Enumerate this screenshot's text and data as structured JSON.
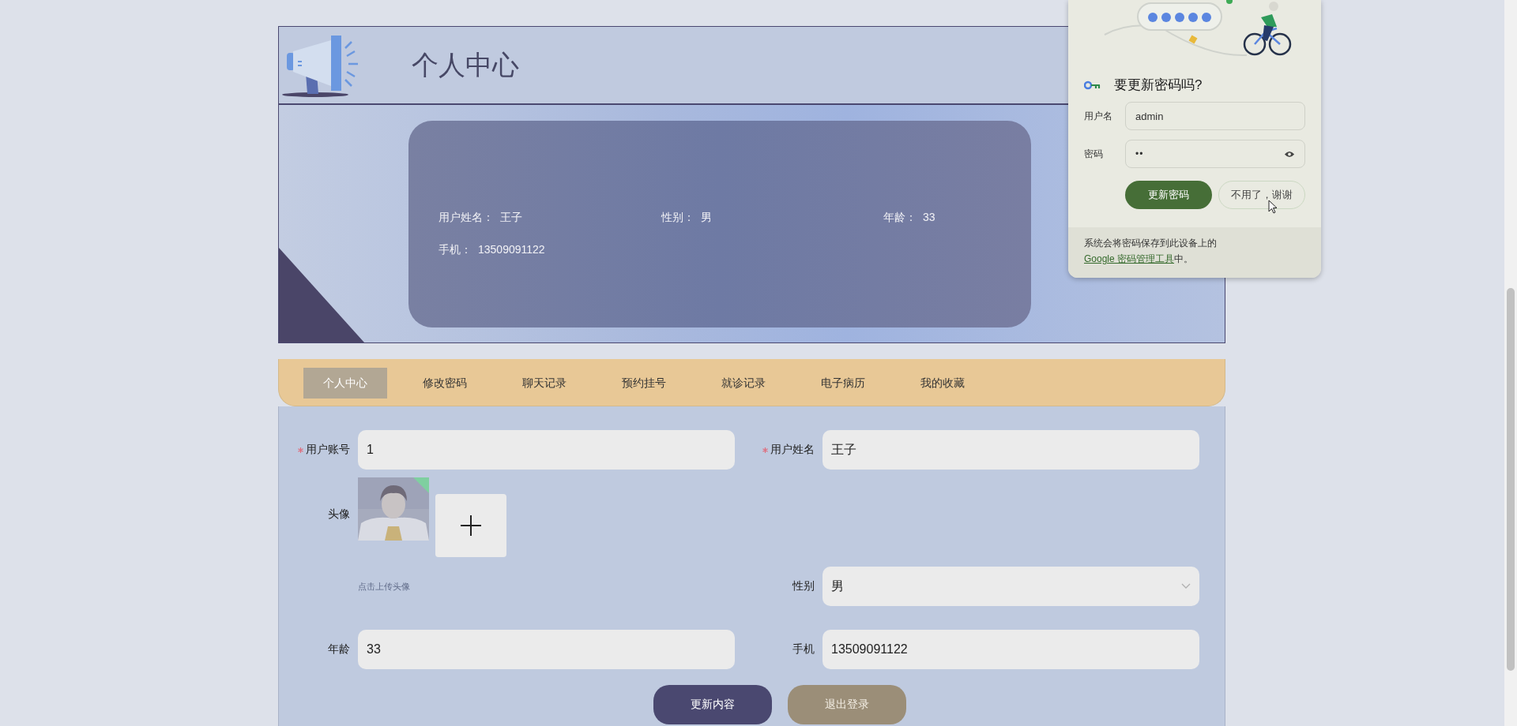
{
  "header": {
    "title": "个人中心"
  },
  "profile": {
    "fields": [
      {
        "label": "用户姓名：",
        "value": "王子"
      },
      {
        "label": "性别：",
        "value": "男"
      },
      {
        "label": "年龄：",
        "value": "33"
      },
      {
        "label": "手机：",
        "value": "13509091122"
      }
    ]
  },
  "tabs": [
    {
      "label": "个人中心",
      "selected": true
    },
    {
      "label": "修改密码",
      "selected": false
    },
    {
      "label": "聊天记录",
      "selected": false
    },
    {
      "label": "预约挂号",
      "selected": false
    },
    {
      "label": "就诊记录",
      "selected": false
    },
    {
      "label": "电子病历",
      "selected": false
    },
    {
      "label": "我的收藏",
      "selected": false
    }
  ],
  "form": {
    "fields": [
      {
        "kind": "text",
        "label": "用户账号",
        "required": true,
        "value": "1"
      },
      {
        "kind": "text",
        "label": "用户姓名",
        "required": true,
        "value": "王子"
      },
      {
        "kind": "avatar",
        "label": "头像",
        "required": false,
        "hint": "点击上传头像"
      },
      {
        "kind": "select",
        "label": "性别",
        "required": false,
        "value": "男"
      },
      {
        "kind": "text",
        "label": "年龄",
        "required": false,
        "value": "33"
      },
      {
        "kind": "text",
        "label": "手机",
        "required": false,
        "value": "13509091122"
      }
    ],
    "buttons": [
      {
        "kind": "primary",
        "label": "更新内容"
      },
      {
        "kind": "secondary",
        "label": "退出登录"
      }
    ]
  },
  "password_prompt": {
    "title": "要更新密码吗?",
    "fields": [
      {
        "kind": "text",
        "label": "用户名",
        "value": "admin"
      },
      {
        "kind": "password",
        "label": "密码",
        "value": "••"
      }
    ],
    "buttons": [
      {
        "kind": "primary",
        "label": "更新密码"
      },
      {
        "kind": "secondary",
        "label": "不用了，谢谢"
      }
    ],
    "footer": {
      "text": "系统会将密码保存到此设备上的",
      "link": "Google 密码管理工具",
      "text_after": "中。"
    }
  }
}
